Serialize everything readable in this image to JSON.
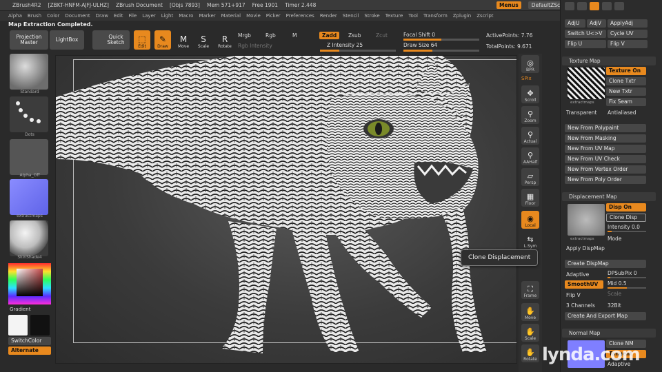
{
  "titlebar": {
    "app": "ZBrush4R2",
    "build": "[ZBKT-HNFM-AJFJ-ULHZ]",
    "document": "ZBrush Document",
    "objs": "[Objs 7893]",
    "mem": "Mem 571+917",
    "free": "Free 1901",
    "timer": "Timer 2.448",
    "menus_label": "Menus",
    "script_label": "DefaultZScript"
  },
  "menubar": [
    "Alpha",
    "Brush",
    "Color",
    "Document",
    "Draw",
    "Edit",
    "File",
    "Layer",
    "Light",
    "Macro",
    "Marker",
    "Material",
    "Movie",
    "Picker",
    "Preferences",
    "Render",
    "Stencil",
    "Stroke",
    "Texture",
    "Tool",
    "Transform",
    "Zplugin",
    "Zscript"
  ],
  "notice": "Map Extraction Completed.",
  "toolbar": {
    "projection_master": "Projection Master",
    "lightbox": "LightBox",
    "quick_sketch": "Quick Sketch",
    "edit": "Edit",
    "draw": "Draw",
    "move": "Move",
    "scale": "Scale",
    "rotate": "Rotate",
    "mrgb": "Mrgb",
    "rgb": "Rgb",
    "m": "M",
    "rgb_intensity": "Rgb Intensity",
    "zadd": "Zadd",
    "zsub": "Zsub",
    "zcut": "Zcut",
    "z_intensity": "Z Intensity 25",
    "z_intensity_value": 25,
    "focal_shift": "Focal Shift 0",
    "focal_shift_value": 0,
    "draw_size": "Draw Size 64",
    "draw_size_value": 64,
    "active_points": "ActivePoints: 7.76",
    "total_points": "TotalPoints: 9.671"
  },
  "leftshelf": {
    "brush": "Standard",
    "stroke": "Dots",
    "alpha": "Alpha_Off",
    "texture": "extractmaps",
    "material": "SkinShade4",
    "gradient": "Gradient",
    "switch_color": "SwitchColor",
    "alternate": "Alternate"
  },
  "rightshelf": {
    "bpr": "BPR",
    "spix": "SPix",
    "scroll": "Scroll",
    "zoom": "Zoom",
    "actual": "Actual",
    "aahalf": "AAHalf",
    "persp": "Persp",
    "floor": "Floor",
    "local": "Local",
    "lsym": "L.Sym",
    "frame": "Frame",
    "move": "Move",
    "scale": "Scale",
    "rotate": "Rotate"
  },
  "tooltip": "Clone Displacement",
  "tray": {
    "adju": "AdjU",
    "adjv": "AdjV",
    "applyadj": "ApplyAdj",
    "switch_uv": "Switch U<>V",
    "cycle_uv": "Cycle UV",
    "flip_u": "Flip U",
    "flip_v": "Flip V",
    "texture_map": {
      "header": "Texture Map",
      "texture_on": "Texture On",
      "clone_txtr": "Clone Txtr",
      "new_txtr": "New Txtr",
      "fix_seam": "Fix Seam",
      "thumb_caption": "extractmaps",
      "transparent": "Transparent",
      "antialiased": "Antialiased",
      "new_from_polypaint": "New From Polypaint",
      "new_from_masking": "New From Masking",
      "new_from_uv_map": "New From UV Map",
      "new_from_uv_check": "New From UV Check",
      "new_from_vertex_order": "New From Vertex Order",
      "new_from_poly_order": "New From Poly Order"
    },
    "displacement_map": {
      "header": "Displacement Map",
      "disp_on": "Disp On",
      "clone_disp": "Clone Disp",
      "intensity": "Intensity 0.0",
      "mode": "Mode",
      "thumb_caption": "extractmaps",
      "apply_dispmap": "Apply DispMap",
      "create_dispmap": "Create DispMap",
      "adaptive": "Adaptive",
      "dpsubpix": "DPSubPix 0",
      "smoothuv": "SmoothUV",
      "mid": "Mid 0.5",
      "flip_v": "Flip V",
      "scale": "Scale",
      "channels": "3 Channels",
      "bit": "32Bit",
      "create_export": "Create And Export Map"
    },
    "normal_map": {
      "header": "Normal Map",
      "clone_nm": "Clone NM",
      "tangent": "Tangent",
      "adaptive": "Adaptive"
    }
  },
  "watermark": "lynda.com",
  "colors": {
    "accent": "#e8891e",
    "panel": "#2c2c2c",
    "viewport": "#3b3b3b"
  }
}
